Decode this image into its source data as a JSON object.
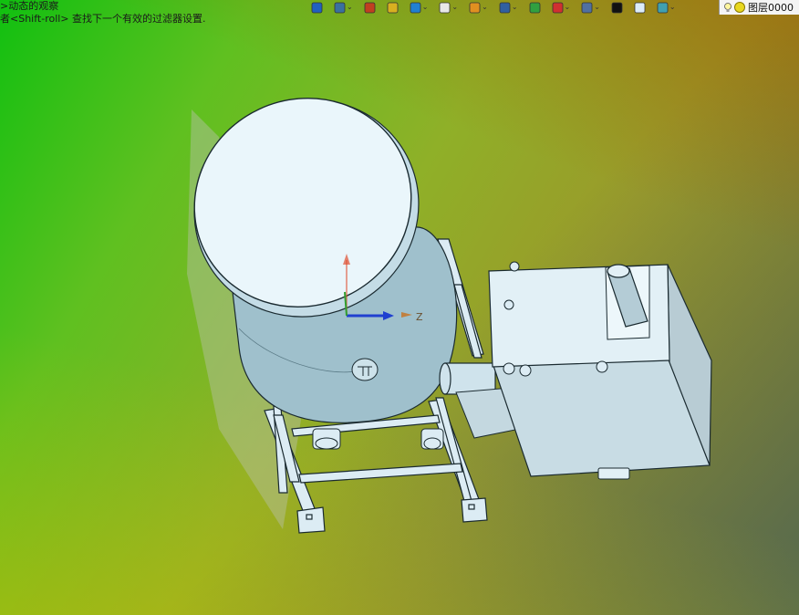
{
  "status": {
    "line1": ">动态的观察",
    "line2": "者<Shift-roll> 查找下一个有效的过滤器设置."
  },
  "toolbar": {
    "buttons": [
      {
        "icon": "view-orient-icon",
        "color": "#2060c0",
        "dropdown": false
      },
      {
        "icon": "display-style-icon",
        "color": "#3a70a0",
        "dropdown": true
      },
      {
        "icon": "pencil-icon",
        "color": "#c04020",
        "dropdown": false
      },
      {
        "icon": "cube-yellow-icon",
        "color": "#d8b020",
        "dropdown": false
      },
      {
        "icon": "cube-blue-icon",
        "color": "#2080d0",
        "dropdown": true
      },
      {
        "icon": "cube-white-icon",
        "color": "#e8e8e8",
        "dropdown": true
      },
      {
        "icon": "render-sphere-icon",
        "color": "#e09020",
        "dropdown": true
      },
      {
        "icon": "magnify-icon",
        "color": "#3060a0",
        "dropdown": true
      },
      {
        "icon": "section-plane-icon",
        "color": "#30a040",
        "dropdown": false
      },
      {
        "icon": "frame-red-icon",
        "color": "#d03030",
        "dropdown": true
      },
      {
        "icon": "monitor-icon",
        "color": "#5070a0",
        "dropdown": true
      },
      {
        "icon": "line-color-icon",
        "color": "#111111",
        "dropdown": false
      },
      {
        "icon": "fill-color-icon",
        "color": "#dcecfa",
        "dropdown": false
      },
      {
        "icon": "layer-stack-icon",
        "color": "#40a0b0",
        "dropdown": true
      }
    ]
  },
  "layer": {
    "label": "图层0000"
  },
  "triad": {
    "z_label": "Z"
  },
  "colors": {
    "model_fill": "#dcecf4",
    "model_edge": "#1a2a30",
    "axis_blue": "#2040d0",
    "axis_red": "#e05030"
  }
}
